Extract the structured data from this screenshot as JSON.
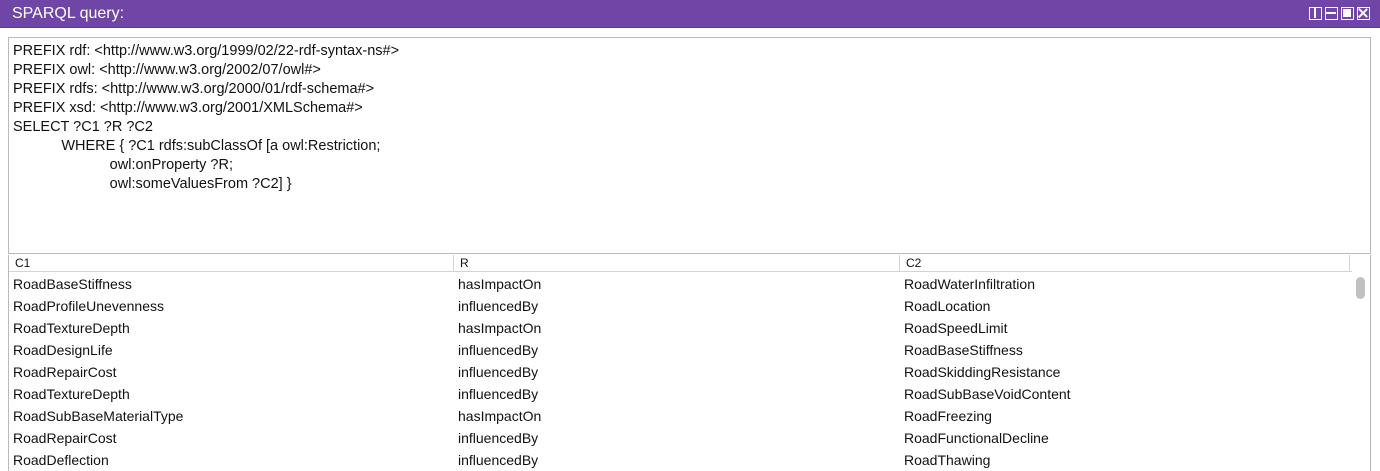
{
  "window": {
    "title": "SPARQL query:"
  },
  "query": {
    "lines": [
      "PREFIX rdf: <http://www.w3.org/1999/02/22-rdf-syntax-ns#>",
      "PREFIX owl: <http://www.w3.org/2002/07/owl#>",
      "PREFIX rdfs: <http://www.w3.org/2000/01/rdf-schema#>",
      "PREFIX xsd: <http://www.w3.org/2001/XMLSchema#>",
      "SELECT ?C1 ?R ?C2",
      "            WHERE { ?C1 rdfs:subClassOf [a owl:Restriction;",
      "                        owl:onProperty ?R;",
      "                        owl:someValuesFrom ?C2] }"
    ]
  },
  "results": {
    "columns": [
      "C1",
      "R",
      "C2"
    ],
    "rows": [
      [
        "RoadBaseStiffness",
        "hasImpactOn",
        "RoadWaterInfiltration"
      ],
      [
        "RoadProfileUnevenness",
        "influencedBy",
        "RoadLocation"
      ],
      [
        "RoadTextureDepth",
        "hasImpactOn",
        "RoadSpeedLimit"
      ],
      [
        "RoadDesignLife",
        "influencedBy",
        "RoadBaseStiffness"
      ],
      [
        "RoadRepairCost",
        "influencedBy",
        "RoadSkiddingResistance"
      ],
      [
        "RoadTextureDepth",
        "influencedBy",
        "RoadSubBaseVoidContent"
      ],
      [
        "RoadSubBaseMaterialType",
        "hasImpactOn",
        "RoadFreezing"
      ],
      [
        "RoadRepairCost",
        "influencedBy",
        "RoadFunctionalDecline"
      ],
      [
        "RoadDeflection",
        "influencedBy",
        "RoadThawing"
      ]
    ]
  },
  "icons": {
    "dock": "dock-view-icon",
    "minimize": "minimize-icon",
    "maximize": "maximize-icon",
    "close": "close-icon"
  },
  "colors": {
    "titlebar": "#6f46a6",
    "title_text": "#ffffff"
  }
}
